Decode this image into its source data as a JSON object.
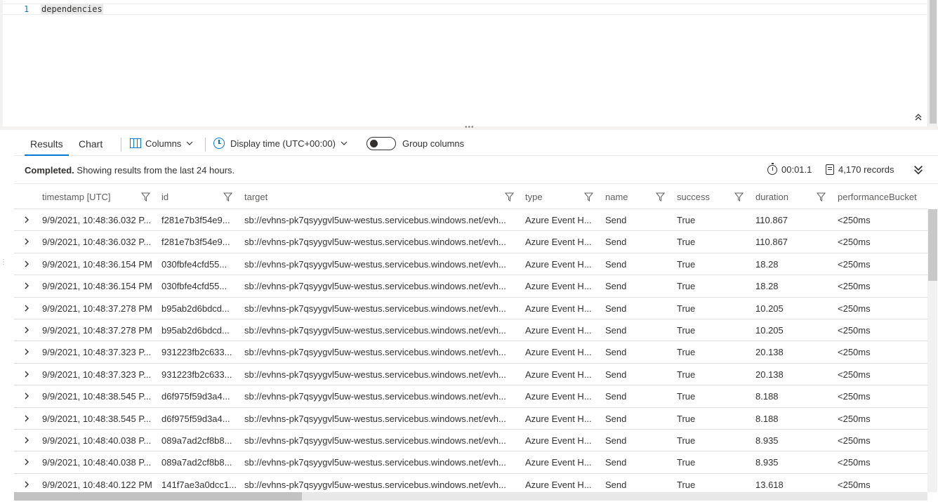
{
  "editor": {
    "line_number": "1",
    "query": "dependencies"
  },
  "toolbar": {
    "tabs": [
      {
        "label": "Results",
        "active": true
      },
      {
        "label": "Chart",
        "active": false
      }
    ],
    "columns_label": "Columns",
    "display_time_label": "Display time (UTC+00:00)",
    "group_columns_label": "Group columns",
    "group_columns_on": false
  },
  "status": {
    "state": "Completed.",
    "message": " Showing results from the last 24 hours.",
    "elapsed": "00:01.1",
    "records": "4,170 records"
  },
  "grid": {
    "columns": [
      "timestamp [UTC]",
      "id",
      "target",
      "type",
      "name",
      "success",
      "duration",
      "performanceBucket"
    ],
    "rows": [
      [
        "9/9/2021, 10:48:36.032 P...",
        "f281e7b3f54e9...",
        "sb://evhns-pk7qsyygvl5uw-westus.servicebus.windows.net/evh...",
        "Azure Event H...",
        "Send",
        "True",
        "110.867",
        "<250ms"
      ],
      [
        "9/9/2021, 10:48:36.032 P...",
        "f281e7b3f54e9...",
        "sb://evhns-pk7qsyygvl5uw-westus.servicebus.windows.net/evh...",
        "Azure Event H...",
        "Send",
        "True",
        "110.867",
        "<250ms"
      ],
      [
        "9/9/2021, 10:48:36.154 PM",
        "030fbfe4cfd55...",
        "sb://evhns-pk7qsyygvl5uw-westus.servicebus.windows.net/evh...",
        "Azure Event H...",
        "Send",
        "True",
        "18.28",
        "<250ms"
      ],
      [
        "9/9/2021, 10:48:36.154 PM",
        "030fbfe4cfd55...",
        "sb://evhns-pk7qsyygvl5uw-westus.servicebus.windows.net/evh...",
        "Azure Event H...",
        "Send",
        "True",
        "18.28",
        "<250ms"
      ],
      [
        "9/9/2021, 10:48:37.278 PM",
        "b95ab2d6bdcd...",
        "sb://evhns-pk7qsyygvl5uw-westus.servicebus.windows.net/evh...",
        "Azure Event H...",
        "Send",
        "True",
        "10.205",
        "<250ms"
      ],
      [
        "9/9/2021, 10:48:37.278 PM",
        "b95ab2d6bdcd...",
        "sb://evhns-pk7qsyygvl5uw-westus.servicebus.windows.net/evh...",
        "Azure Event H...",
        "Send",
        "True",
        "10.205",
        "<250ms"
      ],
      [
        "9/9/2021, 10:48:37.323 P...",
        "931223fb2c633...",
        "sb://evhns-pk7qsyygvl5uw-westus.servicebus.windows.net/evh...",
        "Azure Event H...",
        "Send",
        "True",
        "20.138",
        "<250ms"
      ],
      [
        "9/9/2021, 10:48:37.323 P...",
        "931223fb2c633...",
        "sb://evhns-pk7qsyygvl5uw-westus.servicebus.windows.net/evh...",
        "Azure Event H...",
        "Send",
        "True",
        "20.138",
        "<250ms"
      ],
      [
        "9/9/2021, 10:48:38.545 P...",
        "d6f975f59d3a4...",
        "sb://evhns-pk7qsyygvl5uw-westus.servicebus.windows.net/evh...",
        "Azure Event H...",
        "Send",
        "True",
        "8.188",
        "<250ms"
      ],
      [
        "9/9/2021, 10:48:38.545 P...",
        "d6f975f59d3a4...",
        "sb://evhns-pk7qsyygvl5uw-westus.servicebus.windows.net/evh...",
        "Azure Event H...",
        "Send",
        "True",
        "8.188",
        "<250ms"
      ],
      [
        "9/9/2021, 10:48:40.038 P...",
        "089a7ad2cf8b8...",
        "sb://evhns-pk7qsyygvl5uw-westus.servicebus.windows.net/evh...",
        "Azure Event H...",
        "Send",
        "True",
        "8.935",
        "<250ms"
      ],
      [
        "9/9/2021, 10:48:40.038 P...",
        "089a7ad2cf8b8...",
        "sb://evhns-pk7qsyygvl5uw-westus.servicebus.windows.net/evh...",
        "Azure Event H...",
        "Send",
        "True",
        "8.935",
        "<250ms"
      ],
      [
        "9/9/2021, 10:48:40.122 PM",
        "141f7ae3a0dcc1...",
        "sb://evhns-pk7qsyygvl5uw-westus.servicebus.windows.net/evh...",
        "Azure Event H...",
        "Send",
        "True",
        "13.618",
        "<250ms"
      ]
    ]
  },
  "icons": {
    "columns": "columns-icon",
    "clock": "clock-icon",
    "stopwatch": "stopwatch-icon",
    "records": "records-icon",
    "filter": "filter-icon",
    "expand_row": "chevron-right-icon",
    "collapse_editor": "double-chevron-up-icon",
    "expand_panel": "double-chevron-down-icon"
  },
  "colors": {
    "accent": "#0078d4",
    "text": "#323130",
    "header_text": "#605e5c",
    "divider": "#e1dfdd"
  }
}
